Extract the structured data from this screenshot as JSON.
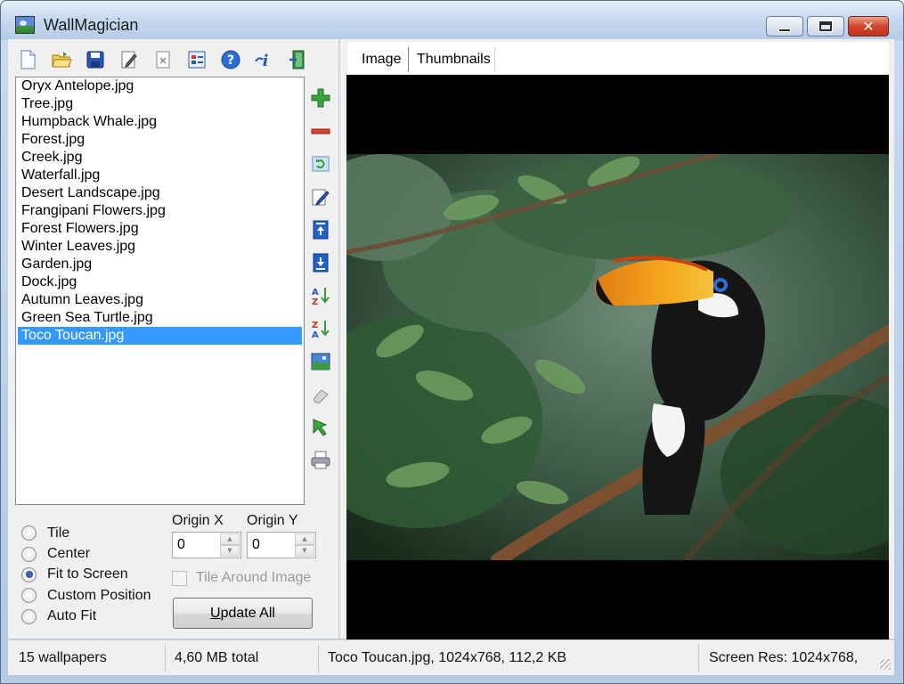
{
  "window": {
    "title": "WallMagician"
  },
  "toolbar": {
    "buttons": [
      {
        "icon": "new-document-icon"
      },
      {
        "icon": "open-folder-icon"
      },
      {
        "icon": "save-disk-icon"
      },
      {
        "icon": "edit-pencil-icon"
      },
      {
        "icon": "close-file-icon"
      },
      {
        "icon": "options-icon"
      },
      {
        "icon": "help-icon"
      },
      {
        "icon": "info-icon"
      },
      {
        "icon": "exit-door-icon"
      }
    ]
  },
  "files": [
    "Oryx Antelope.jpg",
    "Tree.jpg",
    "Humpback Whale.jpg",
    "Forest.jpg",
    "Creek.jpg",
    "Waterfall.jpg",
    "Desert Landscape.jpg",
    "Frangipani Flowers.jpg",
    "Forest Flowers.jpg",
    "Winter Leaves.jpg",
    "Garden.jpg",
    "Dock.jpg",
    "Autumn Leaves.jpg",
    "Green Sea Turtle.jpg",
    "Toco Toucan.jpg"
  ],
  "selected_file_index": 14,
  "sidebar_icons": [
    "add-icon",
    "remove-icon",
    "refresh-icon",
    "rename-icon",
    "move-top-icon",
    "move-bottom-icon",
    "sort-az-icon",
    "sort-za-icon",
    "set-wallpaper-icon",
    "eraser-icon",
    "pointer-icon",
    "print-icon"
  ],
  "layout_modes": {
    "options": [
      "Tile",
      "Center",
      "Fit to Screen",
      "Custom Position",
      "Auto Fit"
    ],
    "selected": "Fit to Screen"
  },
  "origin": {
    "x_label": "Origin X",
    "y_label": "Origin Y",
    "x_value": "0",
    "y_value": "0"
  },
  "tile_around": {
    "label": "Tile Around Image",
    "checked": false
  },
  "update_button": {
    "accel": "U",
    "rest": "pdate All"
  },
  "tabs": [
    {
      "label": "Image"
    },
    {
      "label": "Thumbnails"
    }
  ],
  "status": {
    "count": "15 wallpapers",
    "total": "4,60 MB total",
    "file_info": "Toco Toucan.jpg, 1024x768, 112,2 KB",
    "screen_res": "Screen Res: 1024x768,"
  },
  "colors": {
    "selection": "#3399ff",
    "titlebar": "#c7d9ef",
    "close_button": "#d2442c",
    "toucan_beak": "#f39a1a"
  }
}
